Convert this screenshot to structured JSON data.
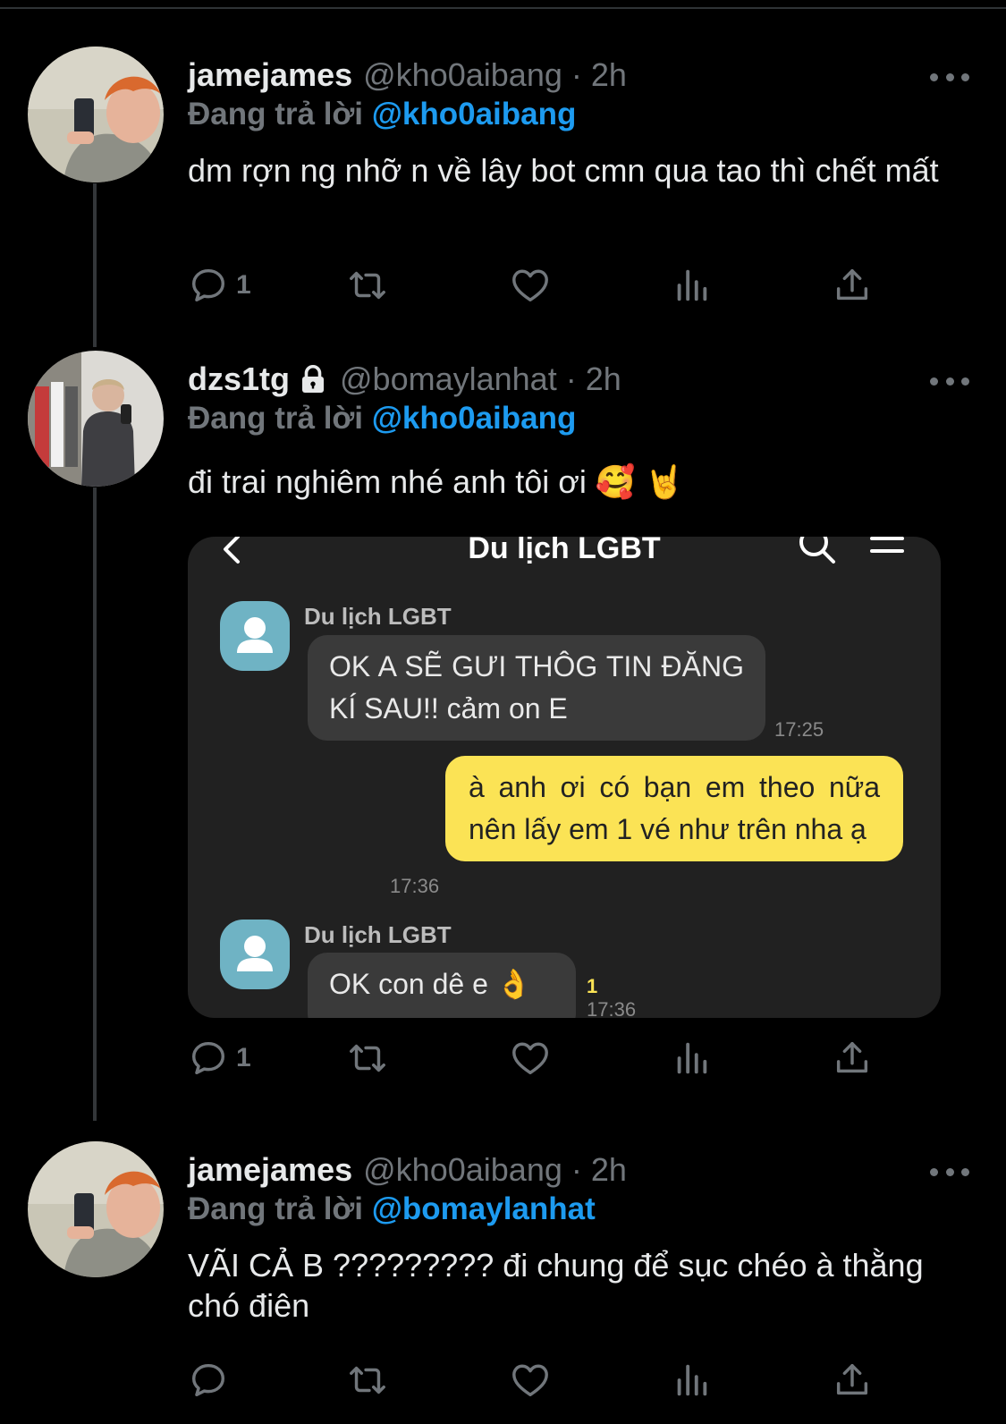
{
  "tweets": [
    {
      "name": "jamejames",
      "handle": "@kho0aibang · 2h",
      "replying_prefix": "Đang trả lời ",
      "replying_to": "@kho0aibang",
      "text": "dm rợn ng nhỡ n về lây bot cmn qua tao thì chết mất",
      "reply_count": "1"
    },
    {
      "name": "dzs1tg",
      "handle": "@bomaylanhat · 2h",
      "replying_prefix": "Đang trả lời ",
      "replying_to": "@kho0aibang",
      "text": "đi trai nghiêm nhé anh tôi ơi 🥰 🤘",
      "reply_count": "1"
    },
    {
      "name": "jamejames",
      "handle": "@kho0aibang · 2h",
      "replying_prefix": "Đang trả lời ",
      "replying_to": "@bomaylanhat",
      "text": "VÃI CẢ B ????????? đi chung để sục chéo à thằng chó điên",
      "reply_count": ""
    }
  ],
  "media": {
    "chat_title": "Du lịch LGBT",
    "messages": [
      {
        "sender": "Du lịch LGBT",
        "text": "OK A SẼ GƯI THÔG TIN ĐĂNG KÍ SAU!! cảm on E",
        "time": "17:25"
      },
      {
        "sender": "",
        "text": "à anh ơi có bạn em theo nữa nên lấy em 1 vé như trên nha ạ",
        "time": "17:36"
      },
      {
        "sender": "Du lịch LGBT",
        "text": "OK con dê e 👌",
        "time": "17:36",
        "unread": "1"
      }
    ]
  },
  "colors": {
    "background": "#000000",
    "mention": "#1d9bf0",
    "muted": "#71767b",
    "chat_bubble_outgoing": "#fbe355",
    "chat_bubble_incoming": "#3a3a3a"
  },
  "icons": [
    "more-icon",
    "reply-icon",
    "retweet-icon",
    "like-icon",
    "views-icon",
    "share-icon",
    "lock-icon",
    "back-icon",
    "search-icon",
    "menu-icon"
  ]
}
